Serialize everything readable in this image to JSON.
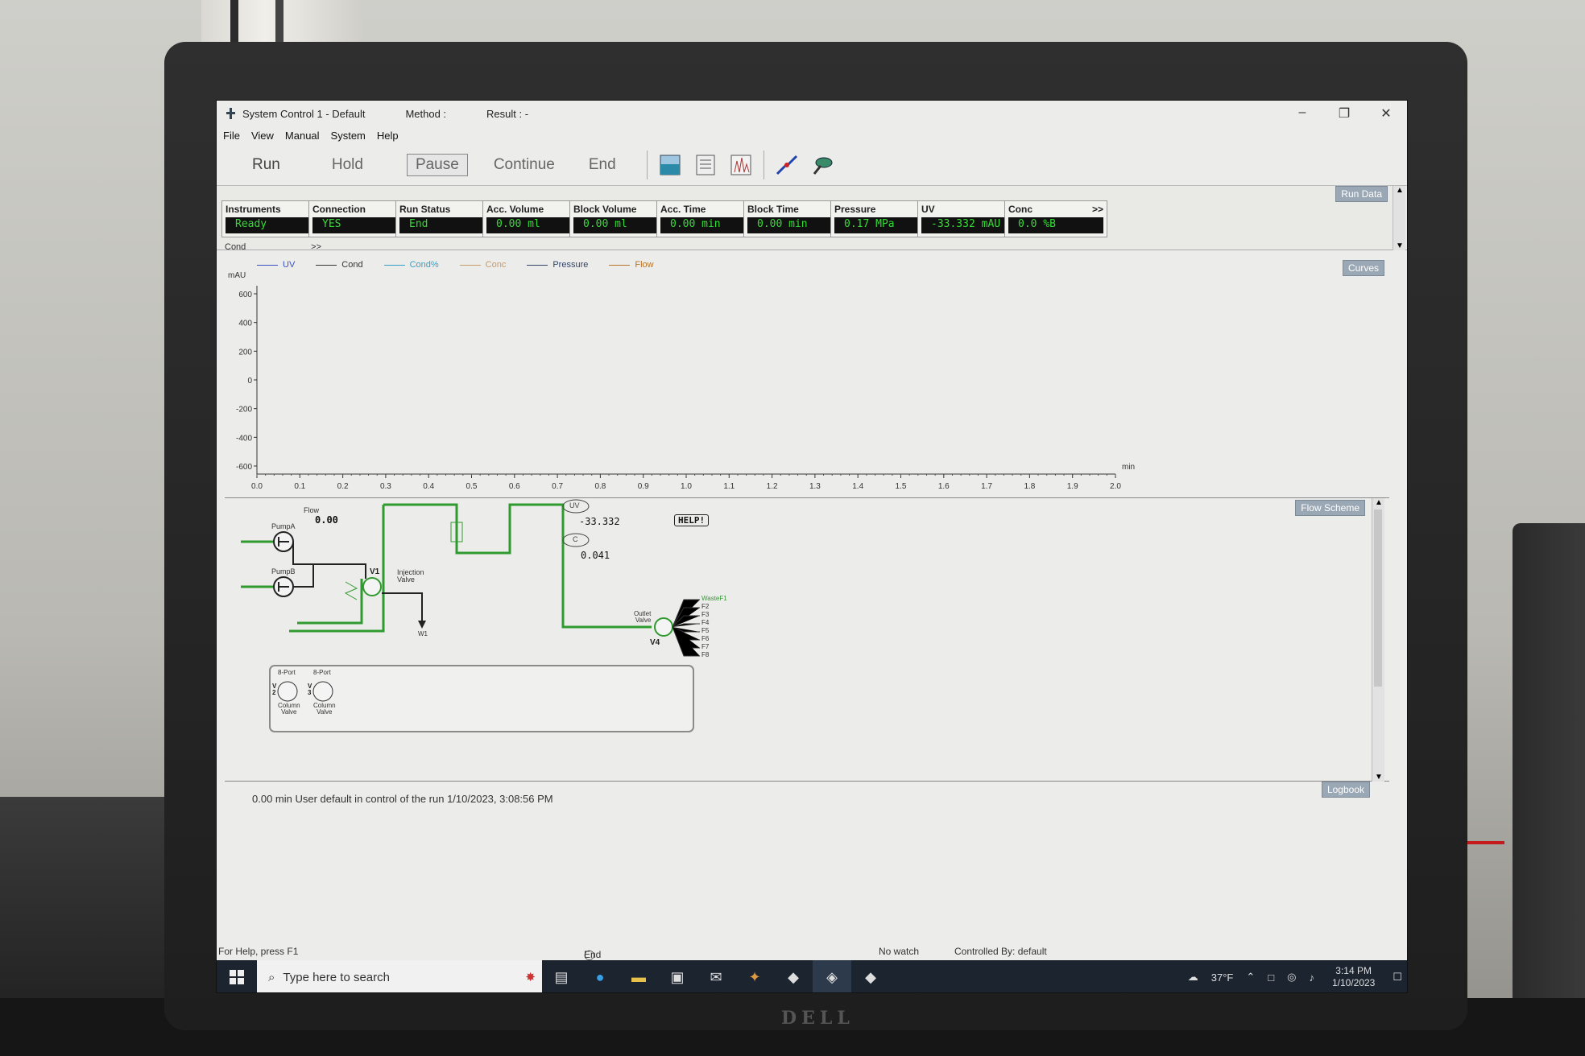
{
  "window": {
    "title": "System Control 1 - Default",
    "method_label": "Method :",
    "result_label": "Result : -"
  },
  "menu": [
    "File",
    "View",
    "Manual",
    "System",
    "Help"
  ],
  "toolbar": {
    "run": "Run",
    "hold": "Hold",
    "pause": "Pause",
    "continue": "Continue",
    "end": "End"
  },
  "run_data": {
    "tag": "Run Data",
    "cells": [
      {
        "label": "Instruments",
        "value": "Ready"
      },
      {
        "label": "Connection",
        "value": "YES"
      },
      {
        "label": "Run Status",
        "value": "End"
      },
      {
        "label": "Acc. Volume",
        "value": "0.00  ml"
      },
      {
        "label": "Block Volume",
        "value": "0.00  ml"
      },
      {
        "label": "Acc. Time",
        "value": "0.00  min"
      },
      {
        "label": "Block Time",
        "value": "0.00  min"
      },
      {
        "label": "Pressure",
        "value": "0.17  MPa",
        "more": ">>"
      },
      {
        "label": "UV",
        "value": "-33.332  mAU",
        "more": ">>"
      },
      {
        "label": "Conc",
        "value": "0.0  %B",
        "more": ">>"
      }
    ],
    "partial_label": "Cond",
    "partial_more": ">>"
  },
  "curves": {
    "tag": "Curves",
    "legend": [
      {
        "name": "UV",
        "color": "#3a4fc4"
      },
      {
        "name": "Cond",
        "color": "#333333"
      },
      {
        "name": "Cond%",
        "color": "#33a0c8"
      },
      {
        "name": "Conc",
        "color": "#c89a66"
      },
      {
        "name": "Pressure",
        "color": "#334466"
      },
      {
        "name": "Flow",
        "color": "#b8742a"
      }
    ]
  },
  "chart_data": {
    "type": "line",
    "ylabel": "mAU",
    "xlabel": "min",
    "ylim": [
      -600,
      600
    ],
    "xlim": [
      0,
      2.0
    ],
    "yticks": [
      "600",
      "400",
      "200",
      "0",
      "-200",
      "-400",
      "-600"
    ],
    "xticks": [
      "0.0",
      "0.1",
      "0.2",
      "0.3",
      "0.4",
      "0.5",
      "0.6",
      "0.7",
      "0.8",
      "0.9",
      "1.0",
      "1.1",
      "1.2",
      "1.3",
      "1.4",
      "1.5",
      "1.6",
      "1.7",
      "1.8",
      "1.9",
      "2.0"
    ],
    "series": []
  },
  "flow_scheme": {
    "tag": "Flow Scheme",
    "flow_label": "Flow",
    "flow_value": "0.00",
    "pump_a": "PumpA",
    "pump_b": "PumpB",
    "v1": "V1",
    "injection_valve_1": "Injection",
    "injection_valve_2": "Valve",
    "w1": "W1",
    "uv_tag": "UV",
    "uv_value": "-33.332",
    "c_tag": "C",
    "c_value": "0.041",
    "help": "HELP!",
    "outlet_1": "Outlet",
    "outlet_2": "Valve",
    "v4": "V4",
    "fractions": [
      "WasteF1",
      "F2",
      "F3",
      "F4",
      "F5",
      "F6",
      "F7",
      "F8"
    ],
    "col_valve_1": {
      "top": "8-Port",
      "id_v": "V",
      "id_n": "2",
      "bottom1": "Column",
      "bottom2": "Valve"
    },
    "col_valve_2": {
      "top": "8-Port",
      "id_v": "V",
      "id_n": "3",
      "bottom1": "Column",
      "bottom2": "Valve"
    }
  },
  "log": {
    "tag": "Logbook",
    "entry": "0.00 min User default in control of the run 1/10/2023, 3:08:56 PM"
  },
  "statusbar": {
    "help": "For Help, press F1",
    "end": "End",
    "watch": "No watch",
    "controlled": "Controlled By: default"
  },
  "taskbar": {
    "search_placeholder": "Type here to search",
    "weather": "37°F",
    "time": "3:14 PM",
    "date": "1/10/2023"
  },
  "monitor_brand": "DELL"
}
